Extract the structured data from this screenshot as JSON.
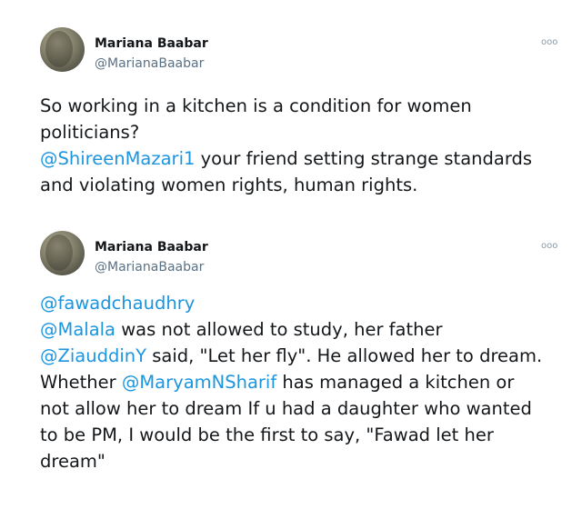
{
  "tweets": [
    {
      "author": {
        "display_name": "Mariana Baabar",
        "handle": "@MarianaBaabar"
      },
      "more_icon": "more-options-icon",
      "more_label": "ooo",
      "lines": [
        {
          "segments": [
            {
              "text": "So working in a kitchen is a condition for women"
            }
          ]
        },
        {
          "segments": [
            {
              "text": "politicians?"
            }
          ]
        },
        {
          "segments": [
            {
              "text": "@ShireenMazari1",
              "mention": true
            },
            {
              "text": " your friend setting strange standards"
            }
          ]
        },
        {
          "segments": [
            {
              "text": "and violating women rights, human rights."
            }
          ]
        }
      ]
    },
    {
      "author": {
        "display_name": "Mariana Baabar",
        "handle": "@MarianaBaabar"
      },
      "more_icon": "more-options-icon",
      "more_label": "ooo",
      "lines": [
        {
          "segments": [
            {
              "text": "@fawadchaudhry",
              "mention": true
            }
          ]
        },
        {
          "segments": [
            {
              "text": "@Malala",
              "mention": true
            },
            {
              "text": " was not allowed to study, her father"
            }
          ]
        },
        {
          "segments": [
            {
              "text": "@ZiauddinY",
              "mention": true
            },
            {
              "text": " said, \"Let her fly\". He allowed her to dream."
            }
          ]
        },
        {
          "segments": [
            {
              "text": "Whether "
            },
            {
              "text": "@MaryamNSharif",
              "mention": true
            },
            {
              "text": " has managed a kitchen or"
            }
          ]
        },
        {
          "segments": [
            {
              "text": "not allow her to dream If u had a daughter who wanted"
            }
          ]
        },
        {
          "segments": [
            {
              "text": "to be PM, I would be the first to say, \"Fawad let her"
            }
          ]
        },
        {
          "segments": [
            {
              "text": "dream\""
            }
          ]
        }
      ]
    }
  ],
  "colors": {
    "text": "#14171a",
    "muted": "#5b7083",
    "link": "#1b95e0"
  }
}
